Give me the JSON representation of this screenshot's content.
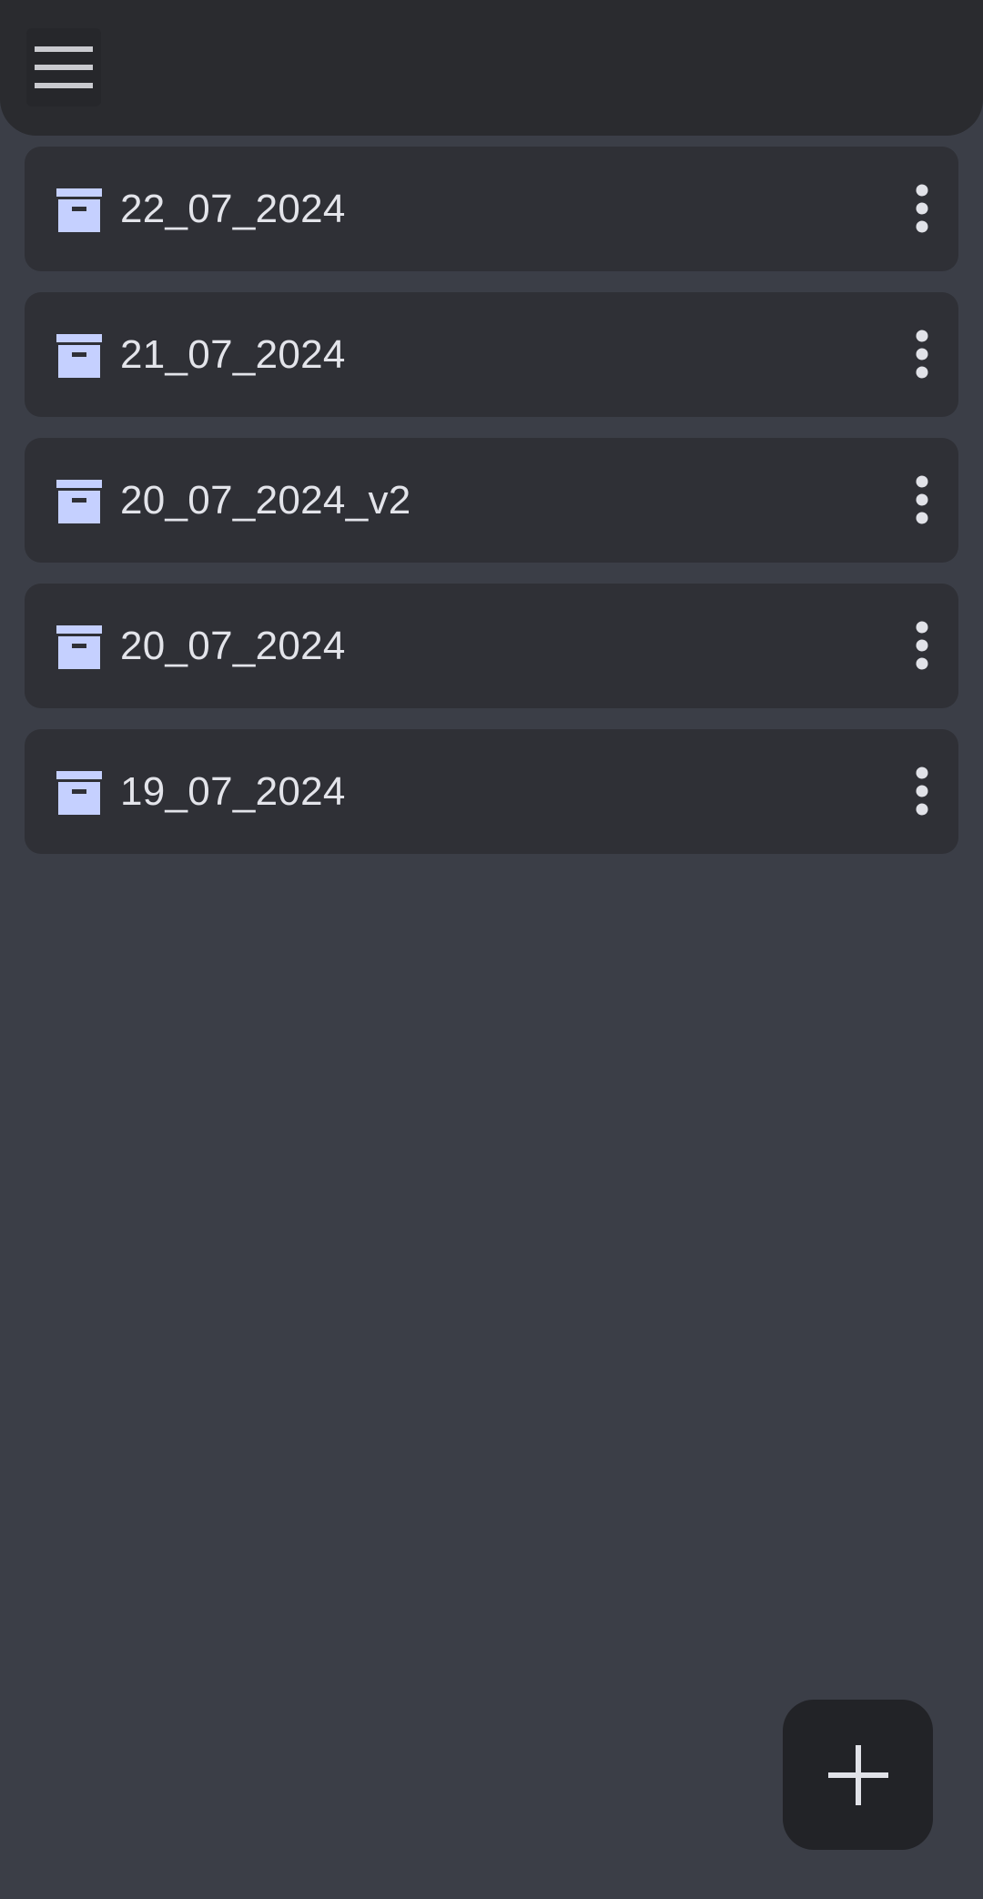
{
  "app_bar": {
    "menu_icon": "hamburger-menu-icon"
  },
  "folders": [
    {
      "label": "22_07_2024",
      "icon": "archive-box-icon",
      "more_icon": "more-vertical-icon"
    },
    {
      "label": "21_07_2024",
      "icon": "archive-box-icon",
      "more_icon": "more-vertical-icon"
    },
    {
      "label": "20_07_2024_v2",
      "icon": "archive-box-icon",
      "more_icon": "more-vertical-icon"
    },
    {
      "label": "20_07_2024",
      "icon": "archive-box-icon",
      "more_icon": "more-vertical-icon"
    },
    {
      "label": "19_07_2024",
      "icon": "archive-box-icon",
      "more_icon": "more-vertical-icon"
    }
  ],
  "fab": {
    "icon": "plus-icon"
  },
  "colors": {
    "background": "#3b3e47",
    "app_bar": "#2a2b2f",
    "card": "#2f3036",
    "icon_accent": "#c5d0ff",
    "text": "#e3e4ea",
    "fab": "#222327"
  }
}
